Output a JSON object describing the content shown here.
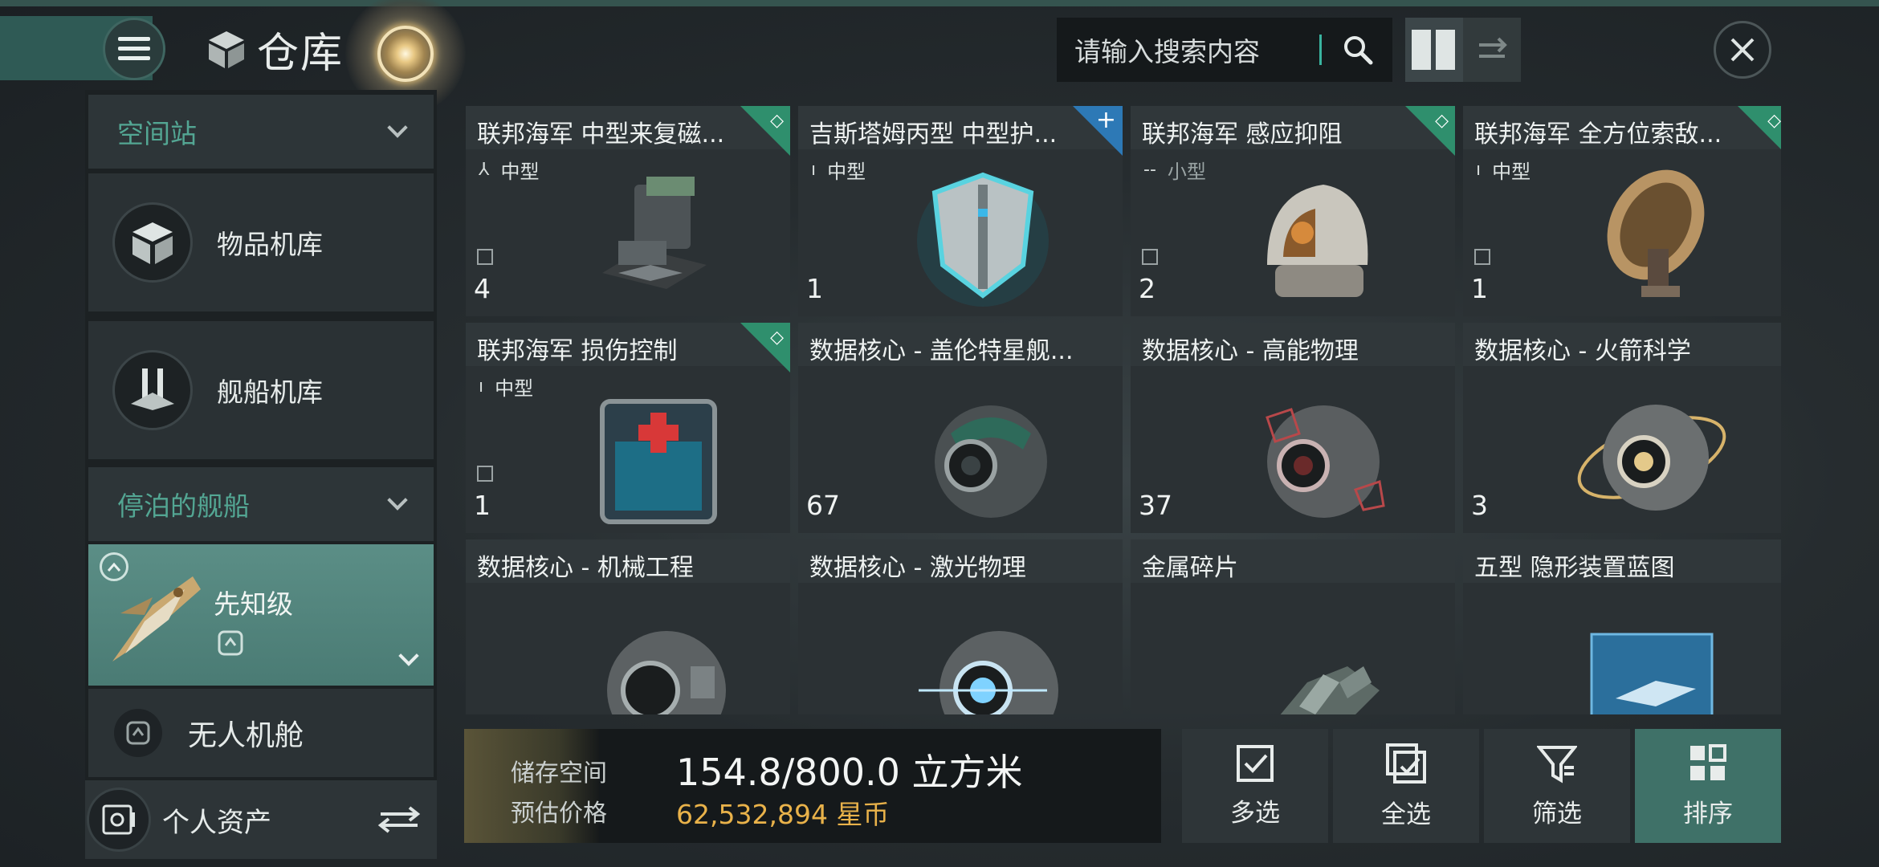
{
  "header": {
    "title": "仓库",
    "search_placeholder": "请输入搜索内容"
  },
  "sidebar": {
    "section_station": "空间站",
    "item_hangar": "物品机库",
    "ship_hangar": "舰船机库",
    "section_docked": "停泊的舰船",
    "docked_ship": "先知级",
    "drone_bay": "无人机舱",
    "personal_assets": "个人资产"
  },
  "items": [
    {
      "name": "联邦海军 中型来复磁...",
      "size": "中型",
      "qty": "4",
      "badge": "diamond"
    },
    {
      "name": "吉斯塔姆丙型 中型护...",
      "size": "中型",
      "qty": "1",
      "badge": "plus"
    },
    {
      "name": "联邦海军 感应抑阻",
      "size": "小型",
      "qty": "2",
      "badge": "diamond"
    },
    {
      "name": "联邦海军 全方位索敌...",
      "size": "中型",
      "qty": "1",
      "badge": "diamond"
    },
    {
      "name": "联邦海军 损伤控制",
      "size": "中型",
      "qty": "1",
      "badge": "diamond"
    },
    {
      "name": "数据核心 - 盖伦特星舰...",
      "size": "",
      "qty": "67",
      "badge": ""
    },
    {
      "name": "数据核心 - 高能物理",
      "size": "",
      "qty": "37",
      "badge": ""
    },
    {
      "name": "数据核心 - 火箭科学",
      "size": "",
      "qty": "3",
      "badge": ""
    },
    {
      "name": "数据核心 - 机械工程",
      "size": "",
      "qty": "",
      "badge": ""
    },
    {
      "name": "数据核心 - 激光物理",
      "size": "",
      "qty": "",
      "badge": ""
    },
    {
      "name": "金属碎片",
      "size": "",
      "qty": "",
      "badge": ""
    },
    {
      "name": "五型 隐形装置蓝图",
      "size": "",
      "qty": "",
      "badge": ""
    }
  ],
  "storage": {
    "label_space": "储存空间",
    "label_price": "预估价格",
    "space_value": "154.8/800.0 立方米",
    "price_value": "62,532,894 星币"
  },
  "actions": {
    "multi_select": "多选",
    "select_all": "全选",
    "filter": "筛选",
    "sort": "排序"
  },
  "colors": {
    "accent_green": "#2f8f6d",
    "accent_blue": "#2d79b6",
    "price_gold": "#e9b24a",
    "selected_teal": "#4a7b74"
  }
}
